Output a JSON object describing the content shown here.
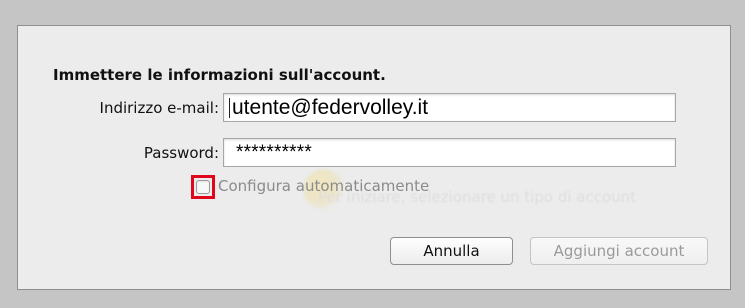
{
  "dialog": {
    "heading": "Immettere le informazioni sull'account.",
    "email_label": "Indirizzo e-mail:",
    "email_value": "utente@federvolley.it",
    "password_label": "Password:",
    "password_value": "**********",
    "auto_config_label": "Configura automaticamente",
    "auto_config_checked": false,
    "cancel_label": "Annulla",
    "add_account_label": "Aggiungi account",
    "add_account_enabled": false
  },
  "background": {
    "ghost_text": "Per iniziare, selezionare un tipo di account"
  },
  "colors": {
    "highlight": "#e0061b",
    "background": "#c5c5c5",
    "dialog": "#ececec"
  }
}
